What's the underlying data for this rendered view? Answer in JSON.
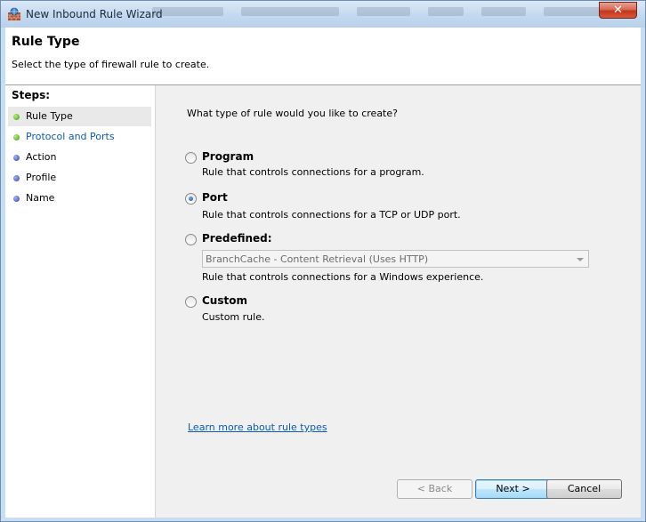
{
  "window": {
    "title": "New Inbound Rule Wizard",
    "close_label": "✕"
  },
  "header": {
    "title": "Rule Type",
    "subtitle": "Select the type of firewall rule to create."
  },
  "steps": {
    "label": "Steps:",
    "items": [
      {
        "label": "Rule Type",
        "status": "current",
        "dot_color": "#3c9a1c"
      },
      {
        "label": "Protocol and Ports",
        "status": "link",
        "dot_color": "#3c9a1c"
      },
      {
        "label": "Action",
        "status": "pending",
        "dot_color": "#2c3fa8"
      },
      {
        "label": "Profile",
        "status": "pending",
        "dot_color": "#2c3fa8"
      },
      {
        "label": "Name",
        "status": "pending",
        "dot_color": "#2c3fa8"
      }
    ]
  },
  "main": {
    "question": "What type of rule would you like to create?",
    "options": [
      {
        "title": "Program",
        "description": "Rule that controls connections for a program.",
        "selected": false
      },
      {
        "title": "Port",
        "description": "Rule that controls connections for a TCP or UDP port.",
        "selected": true
      },
      {
        "title": "Predefined:",
        "description": "Rule that controls connections for a Windows experience.",
        "selected": false
      },
      {
        "title": "Custom",
        "description": "Custom rule.",
        "selected": false
      }
    ],
    "predefined_select": {
      "value": "BranchCache - Content Retrieval (Uses HTTP)",
      "enabled": false
    },
    "learn_link": "Learn more about rule types"
  },
  "buttons": {
    "back": "< Back",
    "next": "Next >",
    "cancel": "Cancel"
  },
  "colors": {
    "link": "#0a5bb2",
    "accent": "#3c7fb1"
  }
}
